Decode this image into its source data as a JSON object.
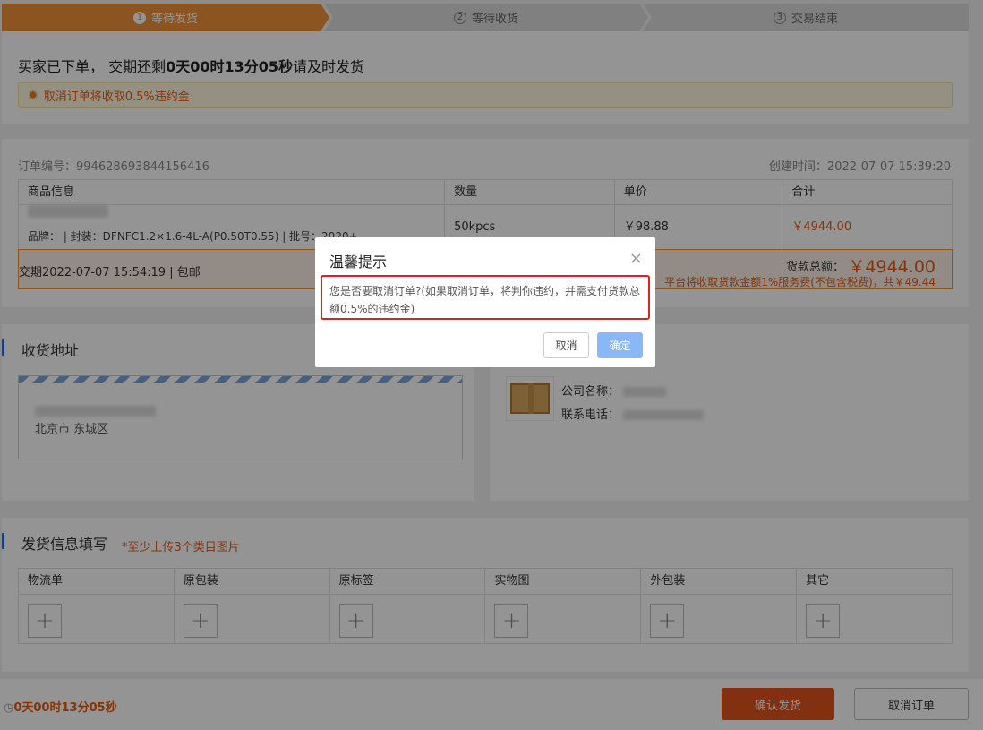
{
  "steps": [
    {
      "num": "1",
      "label": "等待发货"
    },
    {
      "num": "2",
      "label": "等待收货"
    },
    {
      "num": "3",
      "label": "交易结束"
    }
  ],
  "status": {
    "prefix": "买家已下单， 交期还剩",
    "countdown": "0天00时13分05秒",
    "suffix": "请及时发货",
    "warning": "取消订单将收取0.5%违约金"
  },
  "order": {
    "order_no": "订单编号：994628693844156416",
    "created": "创建时间：2022-07-07 15:39:20",
    "headers": [
      "商品信息",
      "数量",
      "单价",
      "合计"
    ],
    "item": {
      "spec": "品牌：        |  封装：DFNFC1.2×1.6-4L-A(P0.50T0.55)  |  批号：2020+",
      "qty": "50kpcs",
      "price": "￥98.88",
      "total": "￥4944.00"
    },
    "delivery": "交期2022-07-07 15:54:19 | 包邮",
    "sum_label": "货款总额：",
    "sum_value": "￥4944.00",
    "fee": "平台将收取货款金额1%服务费(不包含税费)，共￥49.44"
  },
  "address": {
    "title": "收货地址",
    "city": "北京市 东城区"
  },
  "logistics": {
    "company_label": "公司名称：",
    "phone_label": "联系电话："
  },
  "ship": {
    "title": "发货信息填写",
    "requirement": "*至少上传3个类目图片",
    "columns": [
      "物流单",
      "原包装",
      "原标签",
      "实物图",
      "外包装",
      "其它"
    ]
  },
  "bottom": {
    "timer": "0天00时13分05秒",
    "confirm": "确认发货",
    "cancel": "取消订单"
  },
  "modal": {
    "title": "温馨提示",
    "close": "×",
    "body": "您是否要取消订单?(如果取消订单，将判你违约，并需支付货款总额0.5%的违约金)",
    "cancel": "取消",
    "ok": "确定"
  }
}
